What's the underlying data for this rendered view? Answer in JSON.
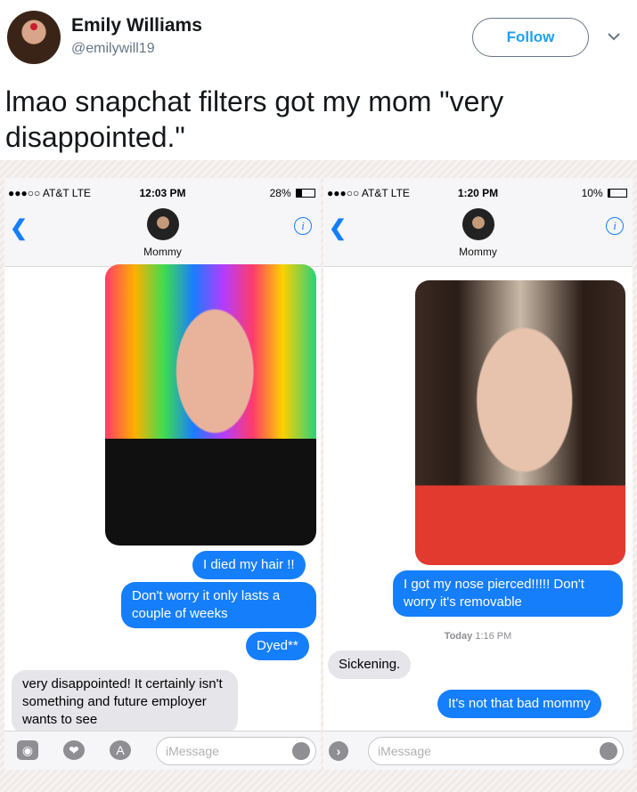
{
  "author": {
    "name": "Emily Williams",
    "handle": "@emilywill19"
  },
  "follow_label": "Follow",
  "tweet_text": "lmao snapchat filters got my mom \"very disappointed.\"",
  "left_phone": {
    "carrier": "●●●○○ AT&T  LTE",
    "time": "12:03 PM",
    "battery": "28%",
    "battery_level": 0.28,
    "contact": "Mommy",
    "messages": {
      "m1": "I died my hair !!",
      "m2": "Don't worry it only lasts a couple of weeks",
      "m3": "Dyed**",
      "m4": "very disappointed! It certainly isn't something and future employer wants to see"
    },
    "input_placeholder": "iMessage"
  },
  "right_phone": {
    "carrier": "●●●○○ AT&T  LTE",
    "time": "1:20 PM",
    "battery": "10%",
    "battery_level": 0.1,
    "contact": "Mommy",
    "messages": {
      "m1": "I got my nose pierced!!!!! Don't worry it's removable",
      "timestamp_day": "Today",
      "timestamp_time": "1:16 PM",
      "m2": "Sickening.",
      "m3": "It's not that bad mommy"
    },
    "input_placeholder": "iMessage"
  },
  "colors": {
    "imessage_blue": "#157efb",
    "twitter_blue": "#1da1f2",
    "grey_bubble": "#e5e5ea"
  },
  "icons": [
    "chevron-down-icon",
    "back-icon",
    "info-icon",
    "camera-icon",
    "heart-icon",
    "app-store-icon",
    "mic-icon",
    "expand-icon"
  ]
}
